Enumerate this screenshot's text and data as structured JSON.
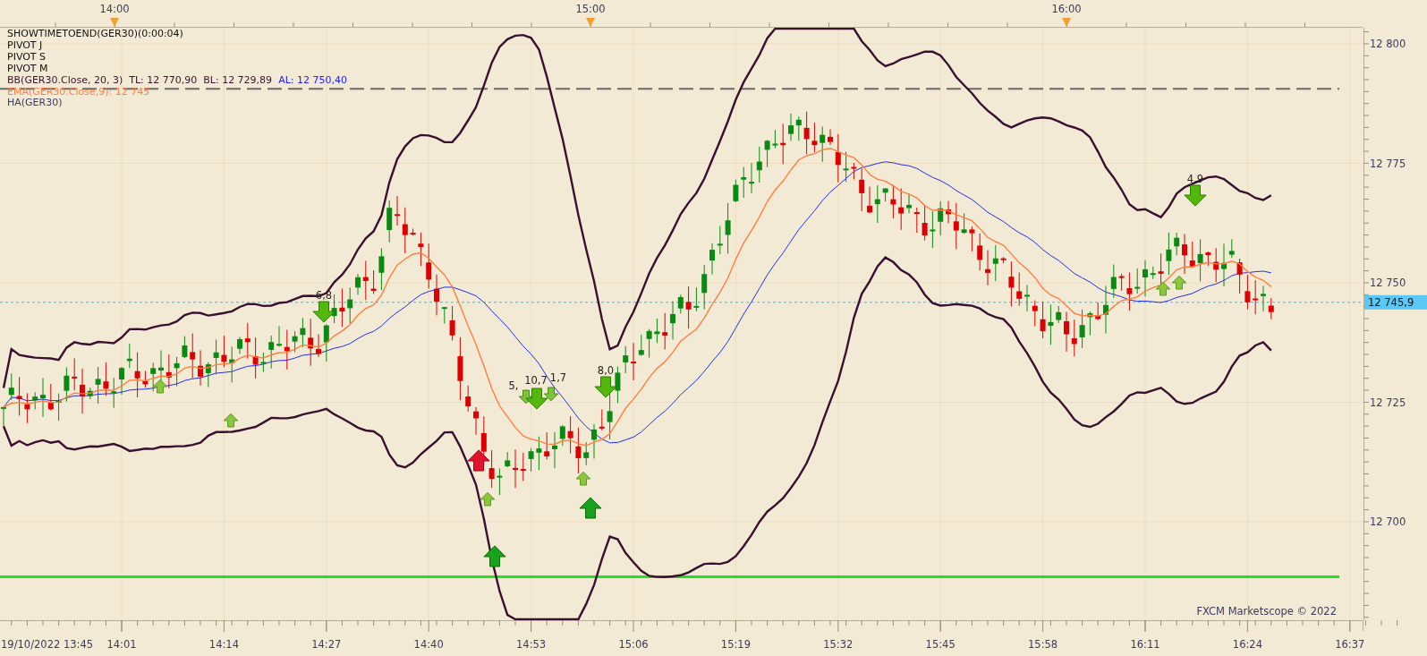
{
  "time_axis_top": {
    "labels": [
      "14:00",
      "15:00",
      "16:00"
    ]
  },
  "legend": [
    {
      "text": "SHOWTIMETOEND(GER30)(0:00:04)",
      "color": "#111111"
    },
    {
      "text": "PIVOT J",
      "color": "#111111"
    },
    {
      "text": "PIVOT S",
      "color": "#111111"
    },
    {
      "text": "PIVOT M",
      "color": "#111111"
    },
    {
      "text": "BB(GER30.Close, 20, 3)  TL: 12 770,90  BL: 12 729,89",
      "color": "#3a1030",
      "suffix": {
        "text": "AL: 12 750,40",
        "color": "#2020ff"
      }
    },
    {
      "text": "EMA(GER30.Close,9): 12 745",
      "color": "#ff7f3f"
    },
    {
      "text": "HA(GER30)",
      "color": "#3a3a6a"
    }
  ],
  "signals": [
    {
      "kind": "down",
      "label": "6,8"
    },
    {
      "kind": "up-small"
    },
    {
      "kind": "up-small"
    },
    {
      "kind": "up-alert"
    },
    {
      "kind": "up-small"
    },
    {
      "kind": "up"
    },
    {
      "kind": "down-small",
      "label": "5,"
    },
    {
      "kind": "down",
      "label": "10,7"
    },
    {
      "kind": "down-small",
      "label": "1,7"
    },
    {
      "kind": "up-small"
    },
    {
      "kind": "up"
    },
    {
      "kind": "down",
      "label": "8,0"
    },
    {
      "kind": "up-small"
    },
    {
      "kind": "up-small"
    },
    {
      "kind": "down",
      "label": "4,9"
    }
  ],
  "credit": "FXCM Marketscope © 2022",
  "price_axis": {
    "labels": [
      "12 800",
      "12 775",
      "12 750",
      "12 725",
      "12 700"
    ],
    "current_price": "12 745,9"
  },
  "time_axis": {
    "labels": [
      "19/10/2022 13:45",
      "14:01",
      "14:14",
      "14:27",
      "14:40",
      "14:53",
      "15:06",
      "15:19",
      "15:32",
      "15:45",
      "15:58",
      "16:11",
      "16:24",
      "16:37"
    ]
  }
}
